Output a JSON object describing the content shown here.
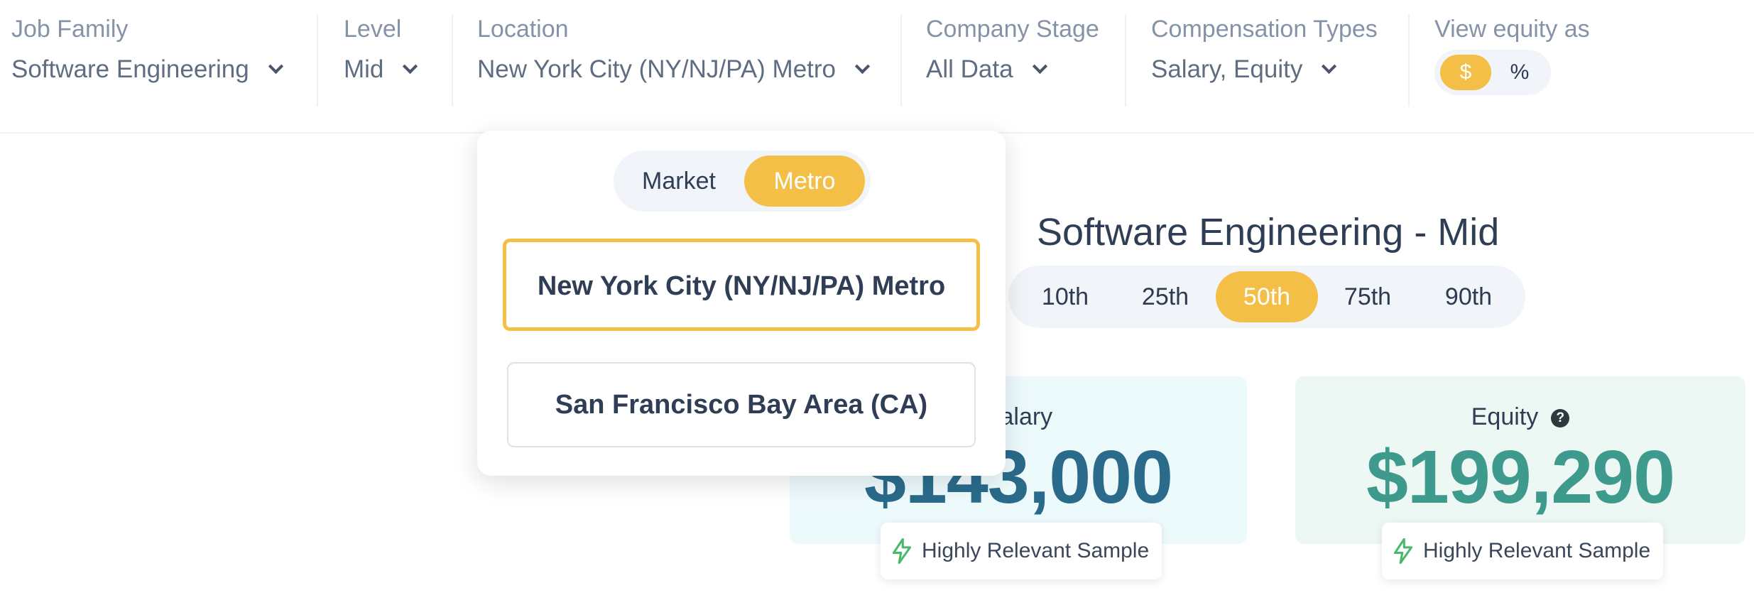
{
  "filters": {
    "job_family": {
      "label": "Job Family",
      "value": "Software Engineering"
    },
    "level": {
      "label": "Level",
      "value": "Mid"
    },
    "location": {
      "label": "Location",
      "value": "New York City (NY/NJ/PA) Metro"
    },
    "company_stage": {
      "label": "Company Stage",
      "value": "All Data"
    },
    "compensation_types": {
      "label": "Compensation Types",
      "value": "Salary, Equity"
    },
    "view_equity": {
      "label": "View equity as",
      "options": [
        "$",
        "%"
      ],
      "selected": "$"
    }
  },
  "location_menu": {
    "scope_options": [
      "Market",
      "Metro"
    ],
    "scope_selected": "Metro",
    "locations": [
      "New York City (NY/NJ/PA) Metro",
      "San Francisco Bay Area (CA)"
    ],
    "selected_location": "New York City (NY/NJ/PA) Metro"
  },
  "main": {
    "title": "Software Engineering - Mid",
    "percentiles": [
      "10th",
      "25th",
      "50th",
      "75th",
      "90th"
    ],
    "selected_percentile": "50th"
  },
  "cards": {
    "salary": {
      "label": "Salary",
      "value": "$143,000",
      "badge": "Highly Relevant Sample"
    },
    "equity": {
      "label": "Equity",
      "help_icon": "?",
      "value": "$199,290",
      "badge": "Highly Relevant Sample"
    }
  },
  "colors": {
    "accent": "#f4bf47",
    "salary_value": "#2a6a8a",
    "equity_value": "#3e9a8c",
    "relevance_icon": "#4cb86c"
  },
  "icons": {
    "filter_chevron": "chevron-down-icon",
    "help": "question-circle-icon",
    "relevance": "lightning-bolt-icon"
  }
}
